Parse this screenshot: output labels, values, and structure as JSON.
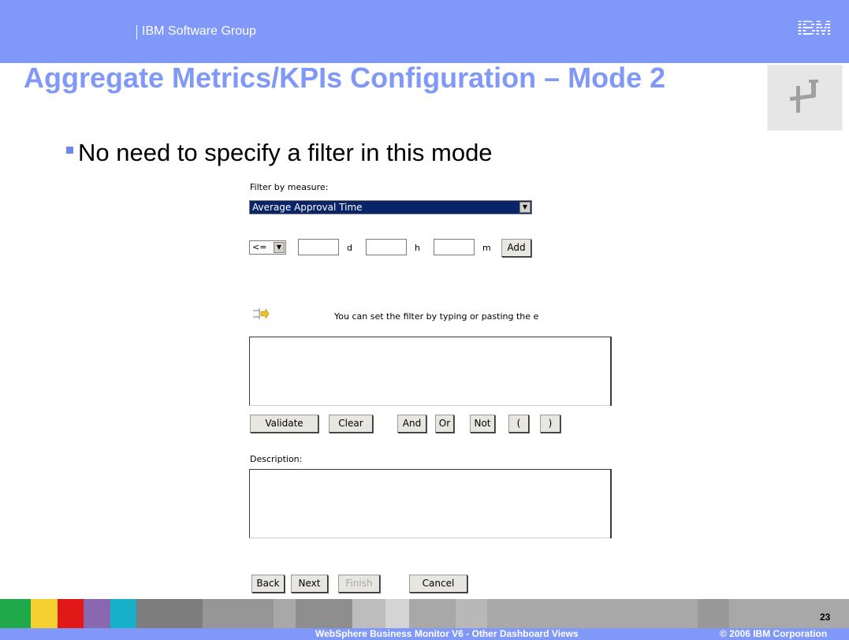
{
  "header": {
    "group_label": "IBM Software Group",
    "logo_text": "IBM"
  },
  "slide": {
    "title": "Aggregate Metrics/KPIs Configuration – Mode 2",
    "bullet": "No need to specify a filter in this mode"
  },
  "dialog": {
    "filter_label": "Filter by measure:",
    "measure_selected": "Average Approval Time",
    "operator_selected": "<=",
    "days_unit": "d",
    "hours_unit": "h",
    "minutes_unit": "m",
    "add_button": "Add",
    "hint_text": "You can set the filter by typing or pasting the e",
    "validate_button": "Validate",
    "clear_button": "Clear",
    "and_button": "And",
    "or_button": "Or",
    "not_button": "Not",
    "open_paren_button": "(",
    "close_paren_button": ")",
    "description_label": "Description:",
    "back_button": "Back",
    "next_button": "Next",
    "finish_button": "Finish",
    "cancel_button": "Cancel"
  },
  "footer": {
    "product": "WebSphere Business Monitor V6 - Other Dashboard Views",
    "copyright": "© 2006 IBM Corporation",
    "page_number": "23"
  },
  "colors": {
    "accent": "#8098f8",
    "selection": "#0a246a"
  }
}
